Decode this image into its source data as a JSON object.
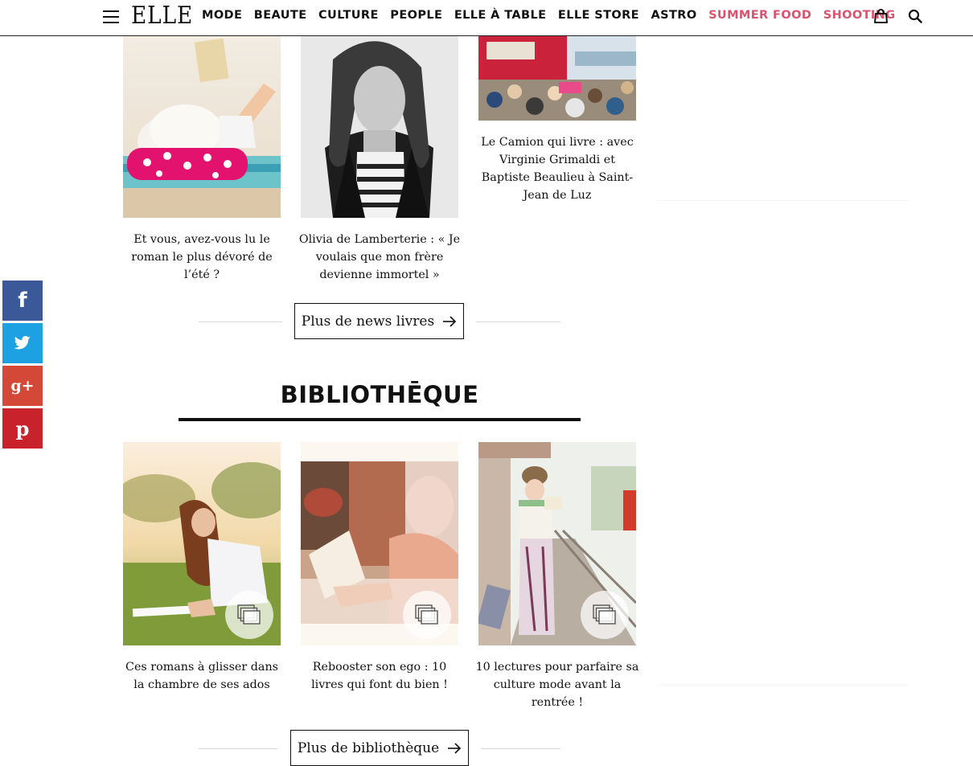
{
  "header": {
    "logo": "ELLE",
    "nav": [
      "MODE",
      "BEAUTE",
      "CULTURE",
      "PEOPLE",
      "ELLE À TABLE",
      "ELLE STORE",
      "ASTRO",
      "SUMMER FOOD",
      "SHOOTING"
    ],
    "accent_color": "#d9536f"
  },
  "news": {
    "cards": [
      {
        "caption": "Et vous, avez-vous lu le roman le plus dévoré de l’été ?"
      },
      {
        "caption": "Olivia de Lamberterie : « Je voulais que mon frère devienne immortel »"
      },
      {
        "caption": "Le Camion qui livre : avec Virginie Grimaldi et Baptiste Beaulieu à Saint-Jean de Luz"
      }
    ],
    "more_label": "Plus de news livres"
  },
  "bibliotheque": {
    "title": "BIBLIOTHĒQUE",
    "cards": [
      {
        "caption": "Ces romans à glisser dans la chambre de ses ados"
      },
      {
        "caption": "Rebooster son ego : 10 livres qui font du bien !"
      },
      {
        "caption": "10 lectures pour parfaire sa culture mode avant la rentrée !"
      }
    ],
    "more_label": "Plus de bibliothèque"
  },
  "social": {
    "facebook_color": "#3b5998",
    "twitter_color": "#1da1e2",
    "googleplus_color": "#d34836",
    "pinterest_color": "#c8232c"
  }
}
